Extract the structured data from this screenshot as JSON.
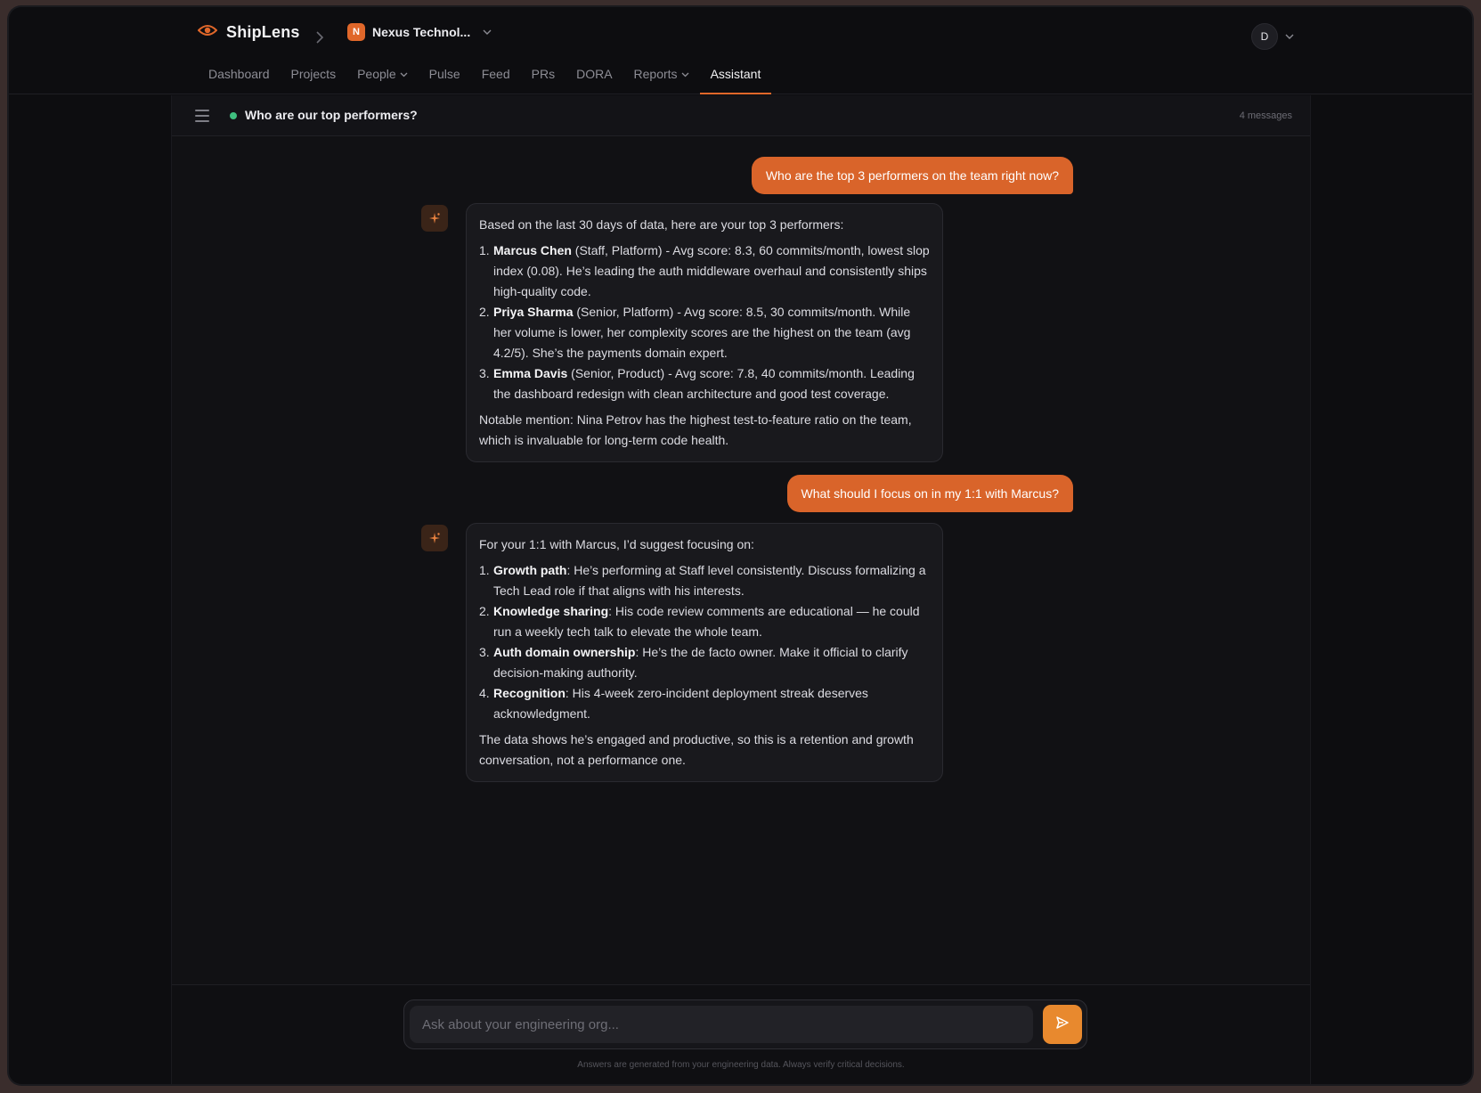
{
  "app": {
    "brand": "ShipLens",
    "org_initial": "N",
    "org_name": "Nexus Technol...",
    "user_initial": "D",
    "accent": "#e0672a"
  },
  "nav": {
    "dashboard": "Dashboard",
    "projects": "Projects",
    "people": "People",
    "pulse": "Pulse",
    "feed": "Feed",
    "prs": "PRs",
    "dora": "DORA",
    "reports": "Reports",
    "assistant": "Assistant"
  },
  "chat": {
    "title": "Who are our top performers?",
    "count": "4 messages"
  },
  "messages": {
    "m1": "Who are the top 3 performers on the team right now?",
    "m2": {
      "intro": "Based on the last 30 days of data, here are your top 3 performers:",
      "items": [
        {
          "num": "1.",
          "name": "Marcus Chen",
          "text": " (Staff, Platform) - Avg score: 8.3, 60 commits/month, lowest slop index (0.08). He’s leading the auth middleware overhaul and consistently ships high-quality code."
        },
        {
          "num": "2.",
          "name": "Priya Sharma",
          "text": " (Senior, Platform) - Avg score: 8.5, 30 commits/month. While her volume is lower, her complexity scores are the highest on the team (avg 4.2/5). She’s the payments domain expert."
        },
        {
          "num": "3.",
          "name": "Emma Davis",
          "text": " (Senior, Product) - Avg score: 7.8, 40 commits/month. Leading the dashboard redesign with clean architecture and good test coverage."
        }
      ],
      "outro": "Notable mention: Nina Petrov has the highest test-to-feature ratio on the team, which is invaluable for long-term code health."
    },
    "m3": "What should I focus on in my 1:1 with Marcus?",
    "m4": {
      "intro": "For your 1:1 with Marcus, I’d suggest focusing on:",
      "items": [
        {
          "num": "1.",
          "name": "Growth path",
          "text": ": He’s performing at Staff level consistently. Discuss formalizing a Tech Lead role if that aligns with his interests."
        },
        {
          "num": "2.",
          "name": "Knowledge sharing",
          "text": ": His code review comments are educational — he could run a weekly tech talk to elevate the whole team."
        },
        {
          "num": "3.",
          "name": "Auth domain ownership",
          "text": ": He’s the de facto owner. Make it official to clarify decision-making authority."
        },
        {
          "num": "4.",
          "name": "Recognition",
          "text": ": His 4-week zero-incident deployment streak deserves acknowledgment."
        }
      ],
      "outro": "The data shows he’s engaged and productive, so this is a retention and growth conversation, not a performance one."
    }
  },
  "composer": {
    "placeholder": "Ask about your engineering org...",
    "disclaimer": "Answers are generated from your engineering data. Always verify critical decisions."
  }
}
